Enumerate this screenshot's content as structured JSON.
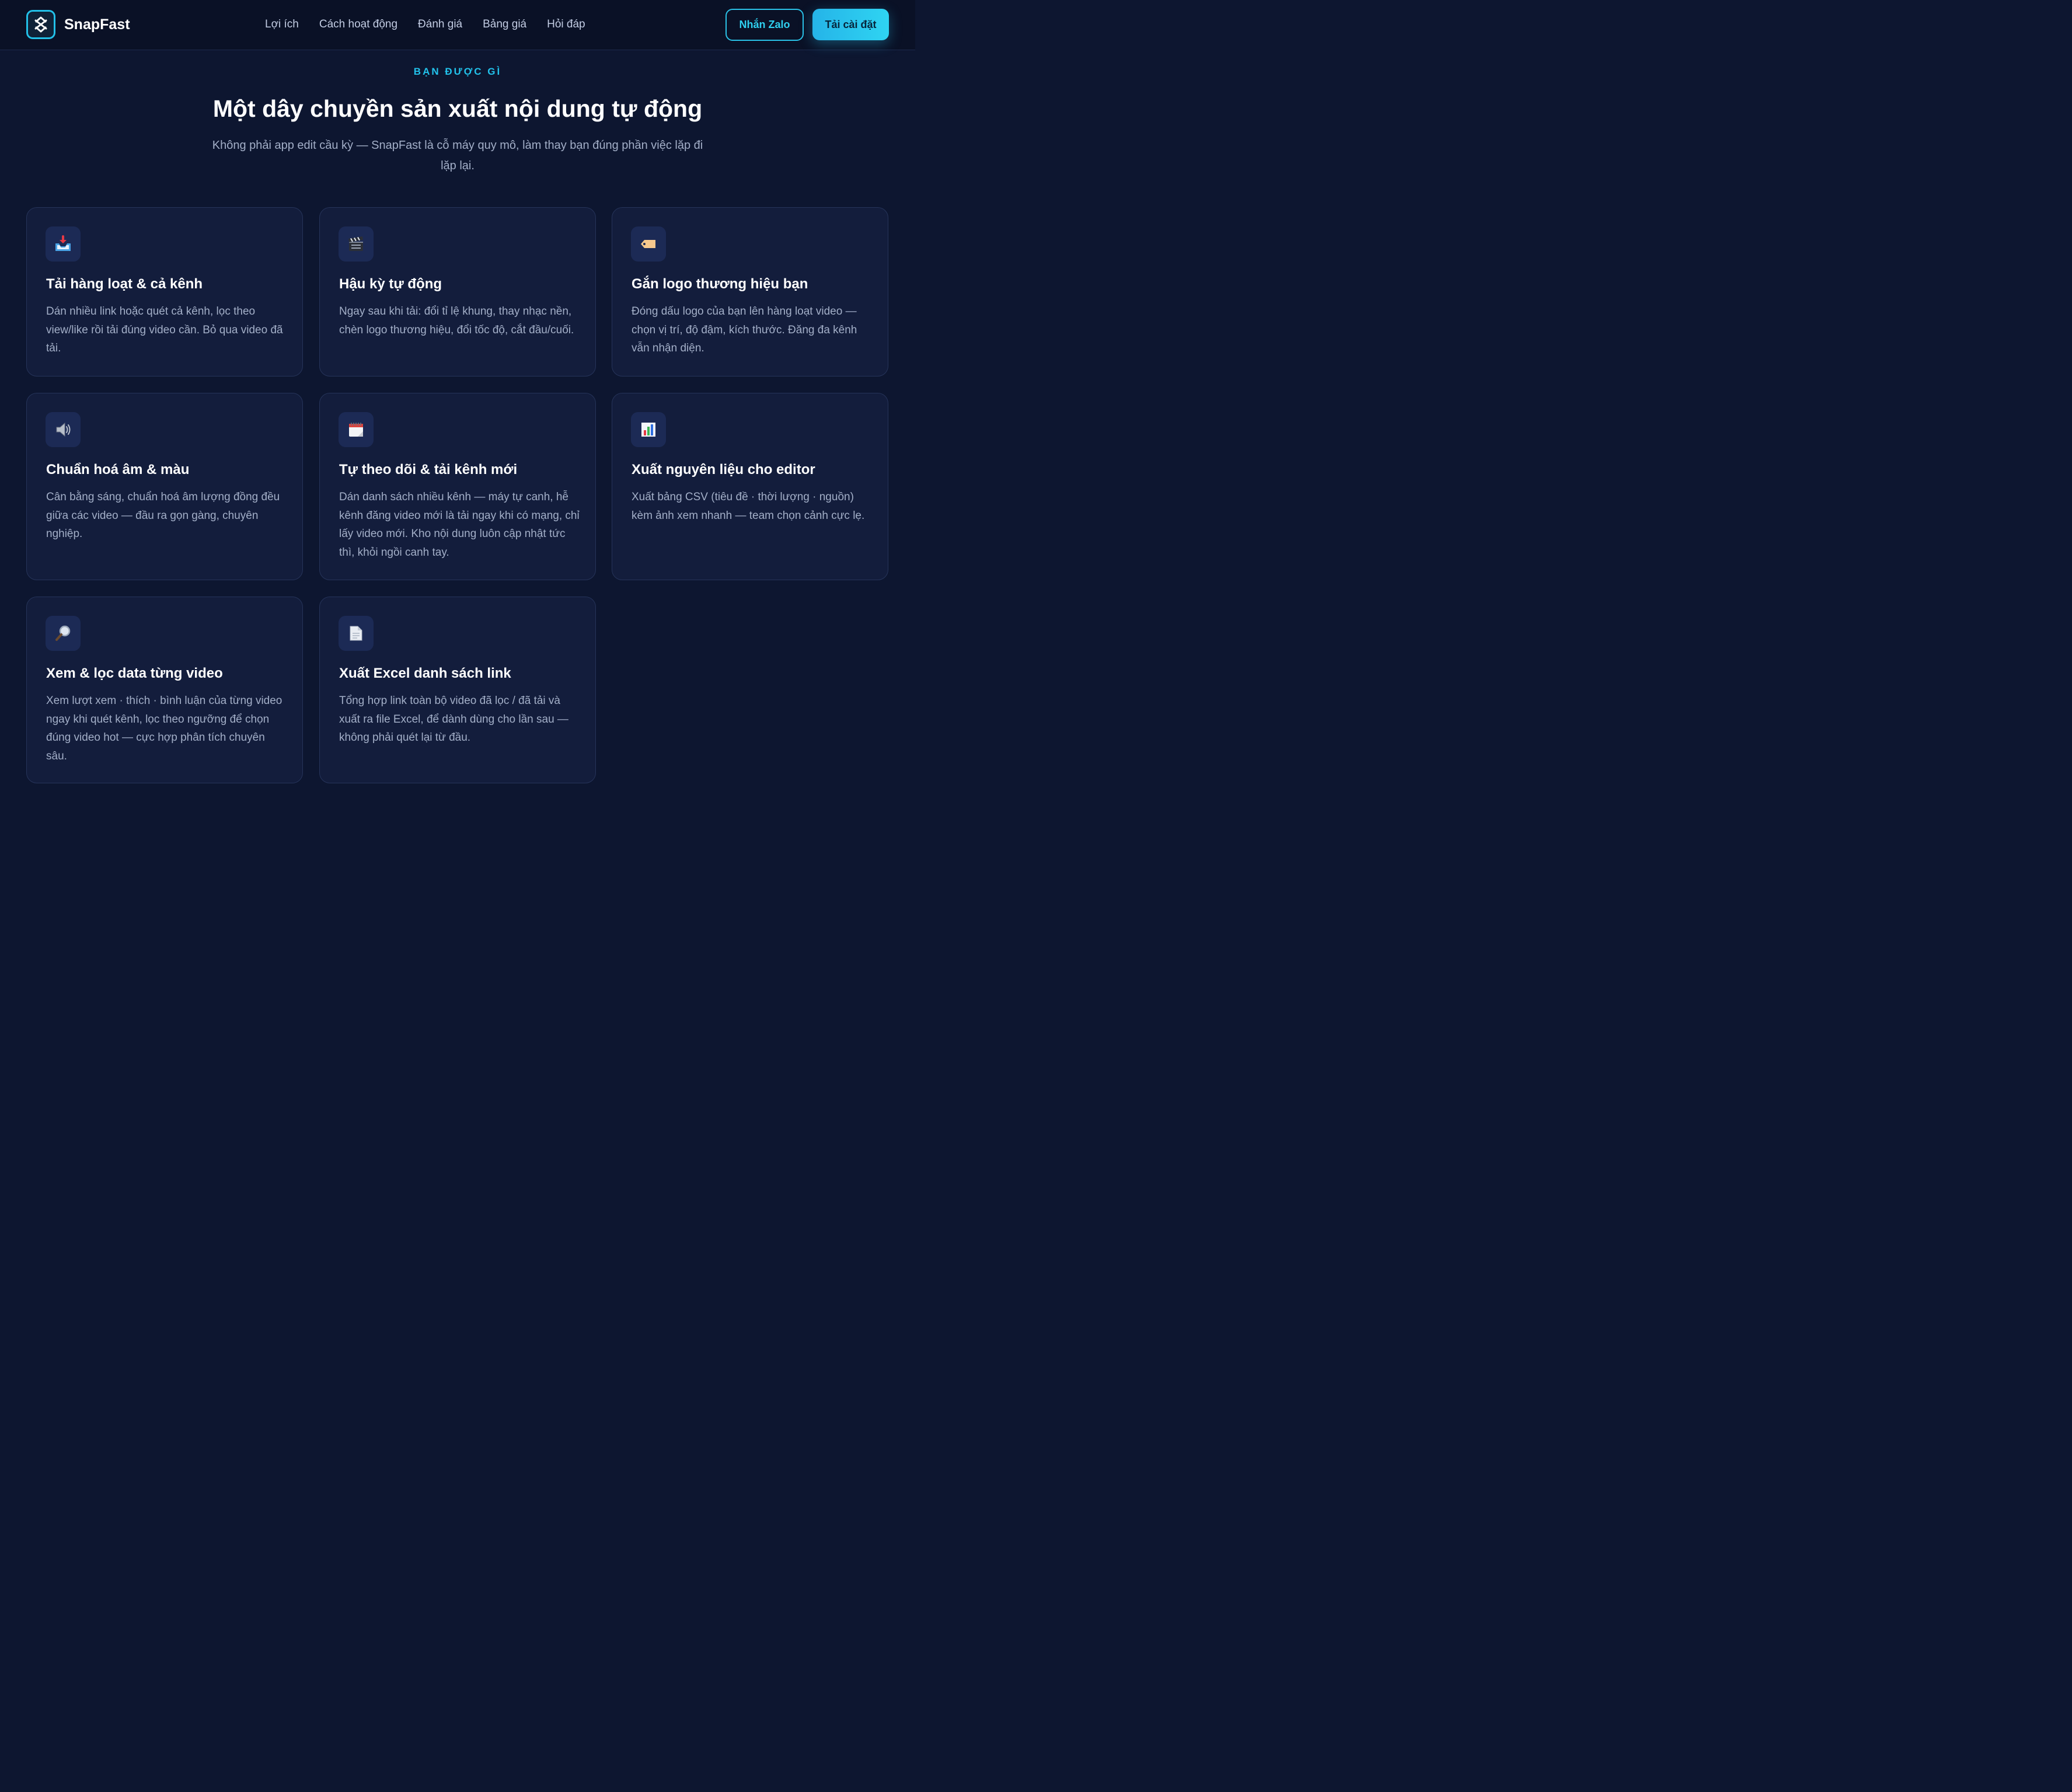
{
  "brand": {
    "name": "SnapFast",
    "logo_icon": "snapfast-logo-icon"
  },
  "nav": {
    "links": [
      "Lợi ích",
      "Cách hoạt động",
      "Đánh giá",
      "Bảng giá",
      "Hỏi đáp"
    ]
  },
  "actions": {
    "zalo_label": "Nhắn Zalo",
    "install_label": "Tải cài đặt"
  },
  "section": {
    "eyebrow": "BẠN ĐƯỢC GÌ",
    "title": "Một dây chuyền sản xuất nội dung tự động",
    "subtitle": "Không phải app edit cầu kỳ — SnapFast là cỗ máy quy mô, làm thay bạn đúng phần việc lặp đi lặp lại."
  },
  "features": [
    {
      "icon": "inbox-download-icon",
      "title": "Tải hàng loạt & cả kênh",
      "desc": "Dán nhiều link hoặc quét cả kênh, lọc theo view/like rồi tải đúng video cần. Bỏ qua video đã tải."
    },
    {
      "icon": "clapperboard-icon",
      "title": "Hậu kỳ tự động",
      "desc": "Ngay sau khi tải: đổi tỉ lệ khung, thay nhạc nền, chèn logo thương hiệu, đổi tốc độ, cắt đầu/cuối."
    },
    {
      "icon": "tag-icon",
      "title": "Gắn logo thương hiệu bạn",
      "desc": "Đóng dấu logo của bạn lên hàng loạt video — chọn vị trí, độ đậm, kích thước. Đăng đa kênh vẫn nhận diện."
    },
    {
      "icon": "speaker-icon",
      "title": "Chuẩn hoá âm & màu",
      "desc": "Cân bằng sáng, chuẩn hoá âm lượng đồng đều giữa các video — đầu ra gọn gàng, chuyên nghiệp."
    },
    {
      "icon": "calendar-icon",
      "title": "Tự theo dõi & tải kênh mới",
      "desc": "Dán danh sách nhiều kênh — máy tự canh, hễ kênh đăng video mới là tải ngay khi có mạng, chỉ lấy video mới. Kho nội dung luôn cập nhật tức thì, khỏi ngồi canh tay."
    },
    {
      "icon": "bar-chart-icon",
      "title": "Xuất nguyên liệu cho editor",
      "desc": "Xuất bảng CSV (tiêu đề · thời lượng · nguồn) kèm ảnh xem nhanh — team chọn cảnh cực lẹ."
    },
    {
      "icon": "magnifier-icon",
      "title": "Xem & lọc data từng video",
      "desc": "Xem lượt xem · thích · bình luận của từng video ngay khi quét kênh, lọc theo ngưỡng để chọn đúng video hot — cực hợp phân tích chuyên sâu."
    },
    {
      "icon": "document-icon",
      "title": "Xuất Excel danh sách link",
      "desc": "Tổng hợp link toàn bộ video đã lọc / đã tải và xuất ra file Excel, để dành dùng cho lần sau — không phải quét lại từ đầu."
    }
  ]
}
